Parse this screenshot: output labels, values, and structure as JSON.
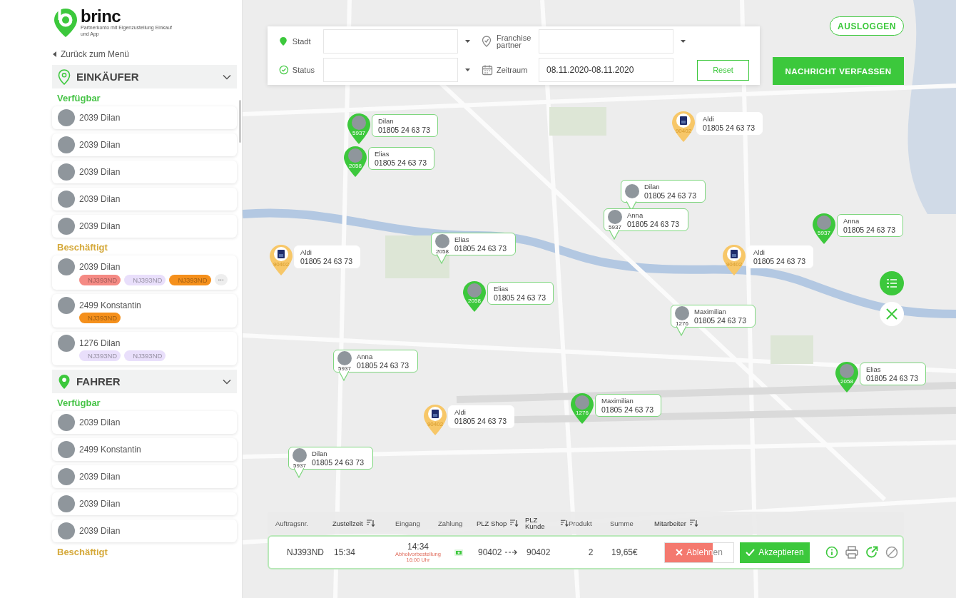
{
  "logo": {
    "brand": "brinc",
    "subtitle": "Partnerkonto mit Eigenzustellung Einkauf und App"
  },
  "back_link": "Zurück zum Menü",
  "groups": [
    {
      "title": "EINKÄUFER",
      "expanded": true,
      "sections": [
        {
          "kind": "available",
          "title": "Verfügbar",
          "people": [
            {
              "name": "2039 Dilan"
            },
            {
              "name": "2039 Dilan"
            },
            {
              "name": "2039 Dilan"
            },
            {
              "name": "2039 Dilan"
            },
            {
              "name": "2039 Dilan"
            }
          ]
        },
        {
          "kind": "busy",
          "title": "Beschäftigt",
          "people": [
            {
              "name": "2039 Dilan",
              "tags": [
                {
                  "label": "NJ393ND",
                  "color": "#f58a84"
                },
                {
                  "label": "NJ393ND",
                  "color": "#e9dffb"
                },
                {
                  "label": "NJ393ND",
                  "color": "#f5901c"
                }
              ],
              "more": "..."
            },
            {
              "name": "2499 Konstantin",
              "tags": [
                {
                  "label": "NJ393ND",
                  "color": "#f5901c"
                }
              ]
            },
            {
              "name": "1276 Dilan",
              "tags": [
                {
                  "label": "NJ393ND",
                  "color": "#e9dffb"
                },
                {
                  "label": "NJ393ND",
                  "color": "#e9dffb"
                }
              ]
            }
          ]
        }
      ]
    },
    {
      "title": "FAHRER",
      "expanded": true,
      "sections": [
        {
          "kind": "available",
          "title": "Verfügbar",
          "people": [
            {
              "name": "2039 Dilan"
            },
            {
              "name": "2499 Konstantin"
            },
            {
              "name": "2039 Dilan"
            },
            {
              "name": "2039 Dilan"
            },
            {
              "name": "2039 Dilan"
            }
          ]
        },
        {
          "kind": "busy",
          "title": "Beschäftigt"
        }
      ]
    }
  ],
  "filters": [
    {
      "kind": "select",
      "label": "Stadt"
    },
    {
      "kind": "select",
      "label": "Franchise partner"
    },
    {
      "kind": "select",
      "label": "Status"
    },
    {
      "kind": "date",
      "label": "Zeitraum",
      "value": "08.11.2020-08.11.2020"
    }
  ],
  "reset_button": "Reset",
  "logout_button": "AUSLOGGEN",
  "compose_button": "NACHRICHT VERFASSEN",
  "markers": [
    {
      "kind": "pin",
      "name": "Dilan",
      "phone": "01805 24 63 73",
      "number": "5937"
    },
    {
      "kind": "pin",
      "name": "Elias",
      "phone": "01805 24 63 73",
      "number": "2058"
    },
    {
      "kind": "shop",
      "name": "Aldi",
      "phone": "01805 24 63 73",
      "number": "90402"
    },
    {
      "kind": "bubble",
      "name": "Dilan",
      "phone": "01805 24 63 73"
    },
    {
      "kind": "bubble",
      "name": "Anna",
      "phone": "01805 24 63 73",
      "number": "5937"
    },
    {
      "kind": "pin",
      "name": "Anna",
      "phone": "01805 24 63 73",
      "number": "5937"
    },
    {
      "kind": "bubble",
      "name": "Elias",
      "phone": "01805 24 63 73",
      "number": "2058"
    },
    {
      "kind": "shop",
      "name": "Aldi",
      "phone": "01805 24 63 73",
      "number": "90402"
    },
    {
      "kind": "shop",
      "name": "Aldi",
      "phone": "01805 24 63 73",
      "number": "90402"
    },
    {
      "kind": "pin",
      "name": "Elias",
      "phone": "01805 24 63 73",
      "number": "2058"
    },
    {
      "kind": "bubble",
      "name": "Maximilian",
      "phone": "01805 24 63 73",
      "number": "1276"
    },
    {
      "kind": "bubble",
      "name": "Anna",
      "phone": "01805 24 63 73",
      "number": "5937"
    },
    {
      "kind": "pin",
      "name": "Elias",
      "phone": "01805 24 63 73",
      "number": "2058"
    },
    {
      "kind": "pin",
      "name": "Maximilian",
      "phone": "01805 24 63 73",
      "number": "1276"
    },
    {
      "kind": "shop",
      "name": "Aldi",
      "phone": "01805 24 63 73",
      "number": "90402"
    },
    {
      "kind": "bubble",
      "name": "Dilan",
      "phone": "01805 24 63 73",
      "number": "5937"
    }
  ],
  "orders": {
    "columns": [
      {
        "label": "Auftragsnr.",
        "sortable": false
      },
      {
        "label": "Zustellzeit",
        "sortable": true
      },
      {
        "label": "Eingang",
        "sortable": false
      },
      {
        "label": "Zahlung",
        "sortable": false
      },
      {
        "label": "PLZ Shop",
        "sortable": true
      },
      {
        "label": "PLZ Kunde",
        "sortable": true
      },
      {
        "label": "Produkt",
        "sortable": false
      },
      {
        "label": "Summe",
        "sortable": false
      },
      {
        "label": "Mitarbeiter",
        "sortable": true
      }
    ],
    "rows": [
      {
        "order_no": "NJ393ND",
        "delivery_time": "15:34",
        "received": "14:34",
        "note": "Abholvorbestellung 16:00 Uhr",
        "plz_shop": "90402",
        "plz_customer": "90402",
        "product": "2",
        "total": "19,65€",
        "reject": {
          "label": "Ablehnen",
          "level": 0.7
        },
        "accept": "Akzeptieren"
      }
    ]
  }
}
